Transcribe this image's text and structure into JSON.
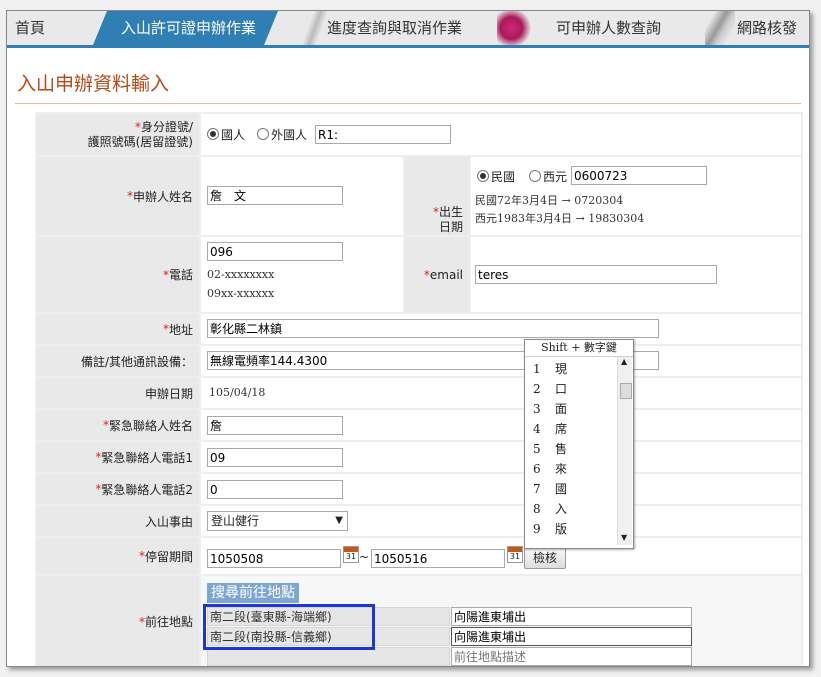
{
  "tabs": {
    "home": "首頁",
    "apply": "入山許可證申辦作業",
    "progress": "進度查詢與取消作業",
    "count": "可申辦人數查詢",
    "network": "網路核發"
  },
  "page_title": "入山申辦資料輸入",
  "form": {
    "id_label_line1": "身分證號/",
    "id_label_line2": "護照號碼(居留證號)",
    "id_opt_local": "國人",
    "id_opt_foreign": "外國人",
    "id_value": "R1:",
    "name_label": "申辦人姓名",
    "name_value": "詹　文",
    "birth_label_line1": "出生",
    "birth_label_line2": "日期",
    "birth_opt_roc": "民國",
    "birth_opt_ad": "西元",
    "birth_value": "0600723",
    "birth_hint_roc": "民國72年3月4日 → 0720304",
    "birth_hint_ad": "西元1983年3月4日 → 19830304",
    "phone_label": "電話",
    "phone_value": "096",
    "phone_hint1": "02-xxxxxxxx",
    "phone_hint2": "09xx-xxxxxx",
    "email_label": "email",
    "email_value": "teres",
    "address_label": "地址",
    "address_value": "彰化縣二林鎮",
    "note_label": "備註/其他通訊設備：",
    "note_value": "無線電頻率144.4300",
    "apply_date_label": "申辦日期",
    "apply_date_value": "105/04/18",
    "ec_name_label": "緊急聯絡人姓名",
    "ec_name_value": "詹",
    "ec_phone1_label": "緊急聯絡人電話1",
    "ec_phone1_value": "09",
    "ec_phone2_label": "緊急聯絡人電話2",
    "ec_phone2_value": "0",
    "reason_label": "入山事由",
    "reason_value": "登山健行",
    "stay_label": "停留期間",
    "stay_from": "1050508",
    "stay_sep": "~",
    "stay_to": "1050516",
    "check_button": "檢核",
    "cal_glyph": "31",
    "dest_label": "前往地點",
    "search_dest": "搜尋前往地點",
    "dest_rows": [
      {
        "area": "南二段(臺東縣-海端鄉)",
        "desc": "向陽進東埔出"
      },
      {
        "area": "南二段(南投縣-信義鄉)",
        "desc": "向陽進東埔出"
      }
    ],
    "dest_placeholder": "前往地點描述"
  },
  "ime": {
    "title": "Shift + 數字鍵",
    "candidates": [
      {
        "n": "1",
        "c": "現"
      },
      {
        "n": "2",
        "c": "口"
      },
      {
        "n": "3",
        "c": "面"
      },
      {
        "n": "4",
        "c": "席"
      },
      {
        "n": "5",
        "c": "售"
      },
      {
        "n": "6",
        "c": "來"
      },
      {
        "n": "7",
        "c": "國"
      },
      {
        "n": "8",
        "c": "入"
      },
      {
        "n": "9",
        "c": "版"
      }
    ]
  },
  "colors": {
    "tab_active": "#2f7fb4",
    "title": "#b34a1a",
    "required": "#e2231a",
    "highlight_box": "#1d36d6"
  }
}
